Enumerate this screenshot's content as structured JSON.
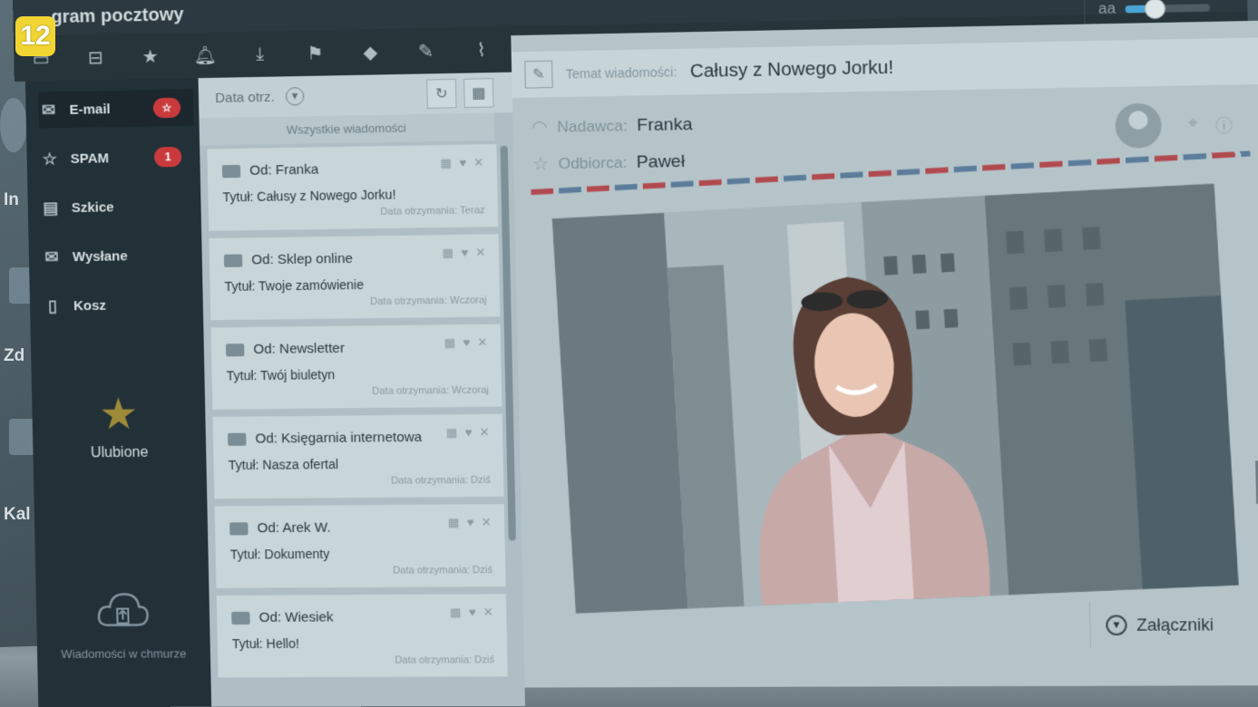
{
  "overlay": {
    "channel_logo": "12"
  },
  "desktop": {
    "labels": [
      "In",
      "Zd",
      "Kal"
    ]
  },
  "window": {
    "title": "gram pocztowy",
    "zoom_label": "aa",
    "zoom_level": 0.35
  },
  "toolbar": {
    "icons": [
      "inbox-icon",
      "archive-icon",
      "star-icon",
      "bell-icon",
      "download-icon",
      "flag-icon",
      "tag-icon",
      "pencil-icon",
      "paperclip-icon",
      "alert-icon",
      "reply-icon",
      "reply-all-icon",
      "forward-icon",
      "trash-icon",
      "print-icon"
    ]
  },
  "sidebar": {
    "items": [
      {
        "label": "E-mail",
        "icon": "mail-icon",
        "badge": "☆"
      },
      {
        "label": "SPAM",
        "icon": "star-outline-icon",
        "badge": "1"
      },
      {
        "label": "Szkice",
        "icon": "document-icon",
        "badge": ""
      },
      {
        "label": "Wysłane",
        "icon": "envelope-icon",
        "badge": ""
      },
      {
        "label": "Kosz",
        "icon": "trash-icon",
        "badge": ""
      }
    ],
    "favorites_label": "Ulubione",
    "cloud_label": "Wiadomości w chmurze"
  },
  "list": {
    "sort_label": "Data otrz.",
    "all_label": "Wszystkie wiadomości",
    "messages": [
      {
        "from": "Od: Franka",
        "subject": "Tytuł: Całusy z Nowego Jorku!",
        "date": "Data otrzymania: Teraz"
      },
      {
        "from": "Od: Sklep online",
        "subject": "Tytuł: Twoje zamówienie",
        "date": "Data otrzymania: Wczoraj"
      },
      {
        "from": "Od: Newsletter",
        "subject": "Tytuł: Twój biuletyn",
        "date": "Data otrzymania: Wczoraj"
      },
      {
        "from": "Od: Księgarnia internetowa",
        "subject": "Tytuł: Nasza ofertal",
        "date": "Data otrzymania: Dziś"
      },
      {
        "from": "Od: Arek W.",
        "subject": "Tytuł: Dokumenty",
        "date": "Data otrzymania: Dziś"
      },
      {
        "from": "Od: Wiesiek",
        "subject": "Tytuł: Hello!",
        "date": "Data otrzymania: Dziś"
      }
    ]
  },
  "reader": {
    "subject_label": "Temat wiadomości:",
    "subject": "Całusy z Nowego Jorku!",
    "sender_label": "Nadawca:",
    "sender": "Franka",
    "recipient_label": "Odbiorca:",
    "recipient": "Paweł",
    "attachments_label": "Załączniki"
  }
}
